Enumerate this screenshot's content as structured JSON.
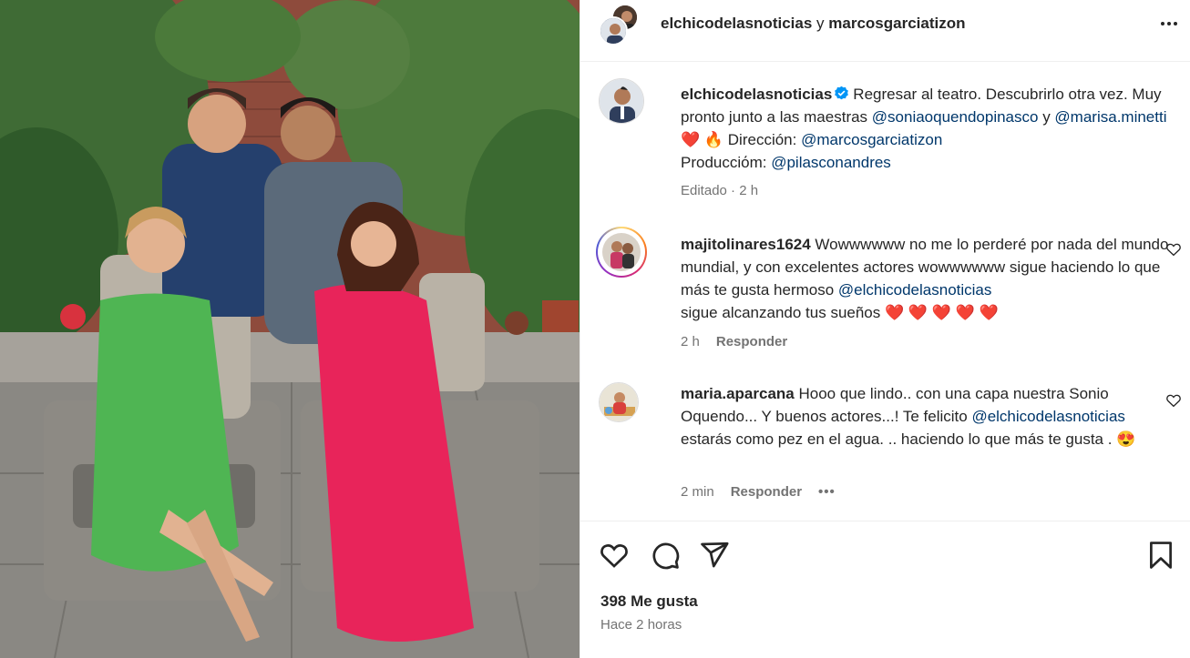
{
  "header": {
    "user1": "elchicodelasnoticias",
    "conj": "y",
    "user2": "marcosgarciatizon"
  },
  "caption": {
    "username": "elchicodelasnoticias",
    "text1": "Regresar al teatro. Descubrirlo otra vez. Muy pronto junto a las maestras ",
    "mention1": "@soniaoquendopinasco",
    "text2": " y ",
    "mention2": "@marisa.minetti",
    "emojis": " ❤️ 🔥 ",
    "text3": " Dirección: ",
    "mention3": "@marcosgarciatizon",
    "text4": "Producciόm: ",
    "mention4": "@pilasconandres",
    "meta": "Editado · 2 h"
  },
  "comments": [
    {
      "username": "majitolinares1624",
      "text1": " Wowwwwww no me lo perderé por nada del mundo mundial, y con excelentes actores wowwwwww sigue haciendo lo que más te gusta hermoso ",
      "mention": "@elchicodelasnoticias",
      "text2": " sigue alcanzando tus sueños ",
      "emojis": "❤️ ❤️ ❤️ ❤️ ❤️",
      "time": "2 h",
      "reply": "Responder"
    },
    {
      "username": "maria.aparcana",
      "text1": " Hooo que lindo.. con una capa nuestra Sonio Oquendo... Y buenos actores...! Te felicito ",
      "mention": "@elchicodelasnoticias",
      "text2": " estarás como pez en el agua. .. haciendo lo que más te gusta . ",
      "emojis": "😍",
      "time": "2 min",
      "reply": "Responder",
      "more": "•••"
    }
  ],
  "footer": {
    "likes": "398 Me gusta",
    "ago": "Hace 2 horas"
  },
  "icons": {
    "like": "heart-icon",
    "comment": "comment-icon",
    "share": "share-icon",
    "save": "bookmark-icon",
    "verified": "verified-badge-icon"
  },
  "colors": {
    "text": "#262626",
    "muted": "#737373",
    "mention": "#00376b",
    "verified": "#0095f6"
  }
}
